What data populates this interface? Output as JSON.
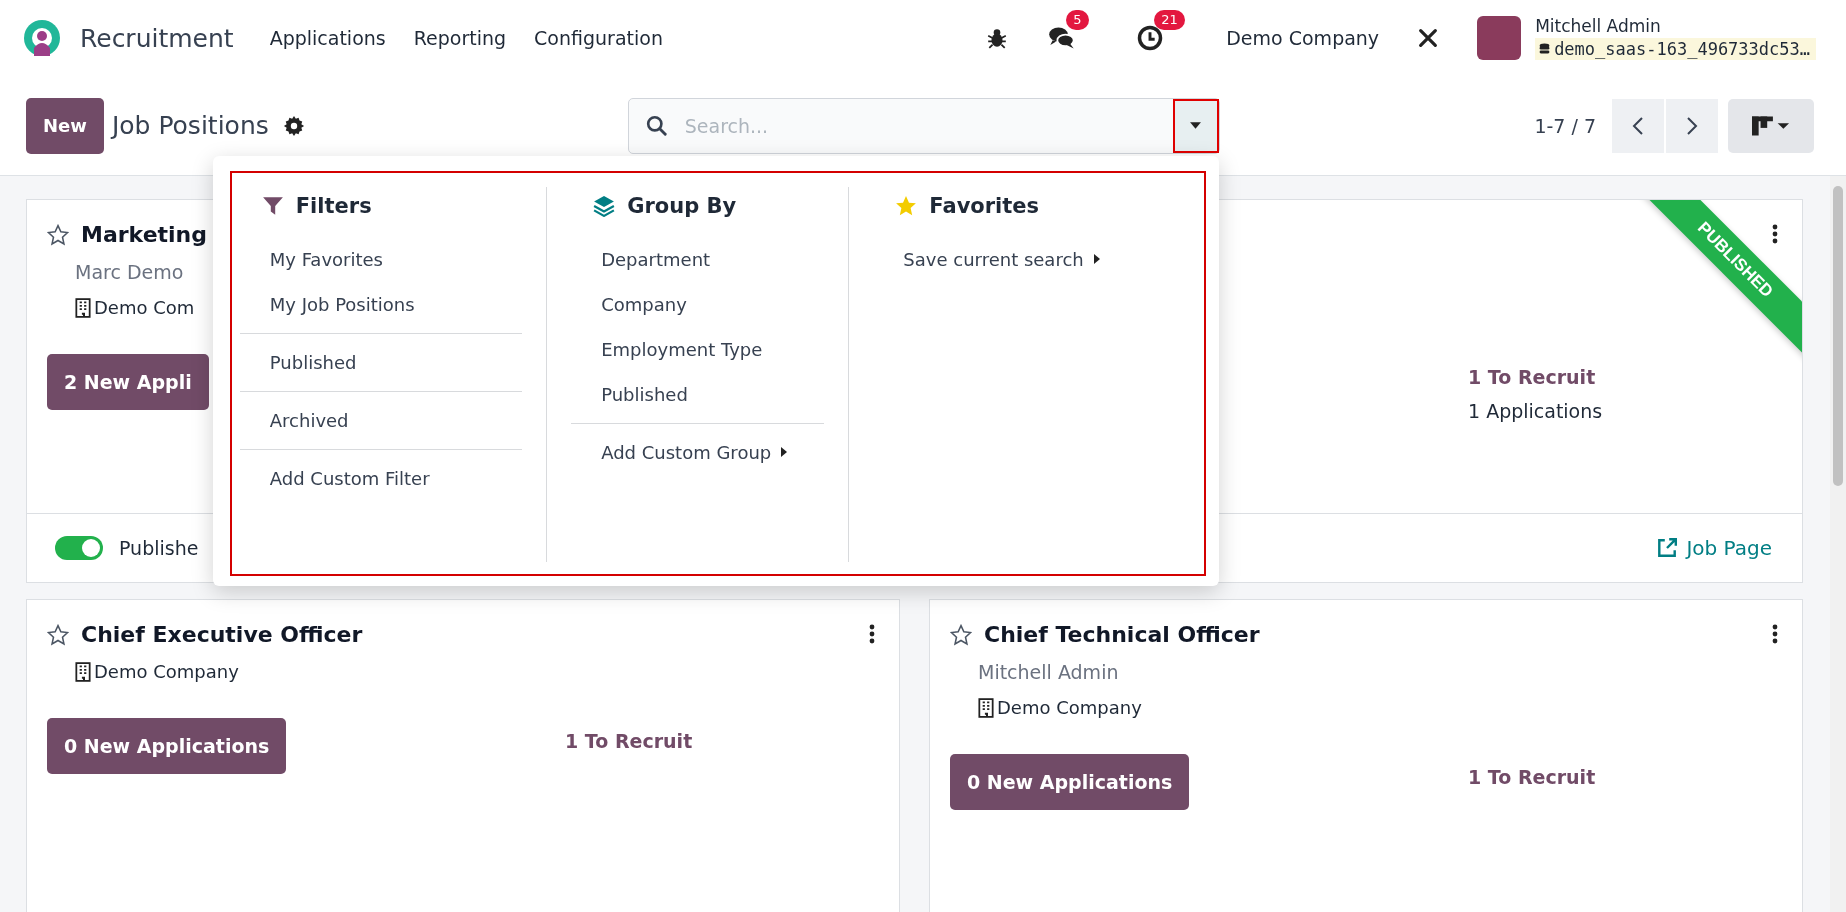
{
  "navbar": {
    "app_name": "Recruitment",
    "menu": [
      "Applications",
      "Reporting",
      "Configuration"
    ],
    "notifications": [
      {
        "kind": "messages",
        "count": "5"
      },
      {
        "kind": "activities",
        "count": "21"
      }
    ],
    "company": "Demo Company",
    "user": {
      "name": "Mitchell Admin",
      "database": "demo_saas-163_496733dc53…"
    }
  },
  "control_panel": {
    "new_button": "New",
    "title": "Job Positions",
    "search": {
      "placeholder": "Search..."
    },
    "pager": "1-7 / 7"
  },
  "search_panel": {
    "filters": {
      "title": "Filters",
      "sections": [
        [
          "My Favorites",
          "My Job Positions"
        ],
        [
          "Published"
        ],
        [
          "Archived"
        ],
        [
          "Add Custom Filter"
        ]
      ]
    },
    "group_by": {
      "title": "Group By",
      "items": [
        "Department",
        "Company",
        "Employment Type",
        "Published"
      ],
      "custom": "Add Custom Group"
    },
    "favorites": {
      "title": "Favorites",
      "items": [
        "Save current search"
      ]
    }
  },
  "cards": [
    {
      "favorite": false,
      "title": "Marketing",
      "manager": "Marc Demo",
      "company": "Demo Com",
      "new_applications": "2 New Appli",
      "published_toggle": {
        "label": "Publishe",
        "on": true
      },
      "menu": false
    },
    {
      "ribbon": "PUBLISHED",
      "to_recruit": "1 To Recruit",
      "applications": "1 Applications",
      "job_page": "Job Page",
      "menu": true
    },
    {
      "favorite": false,
      "title": "Chief Executive Officer",
      "company": "Demo Company",
      "new_applications": "0 New Applications",
      "to_recruit": "1 To Recruit",
      "menu": true
    },
    {
      "favorite": false,
      "title": "Chief Technical Officer",
      "manager": "Mitchell Admin",
      "company": "Demo Company",
      "new_applications": "0 New Applications",
      "to_recruit": "1 To Recruit",
      "menu": true
    }
  ]
}
